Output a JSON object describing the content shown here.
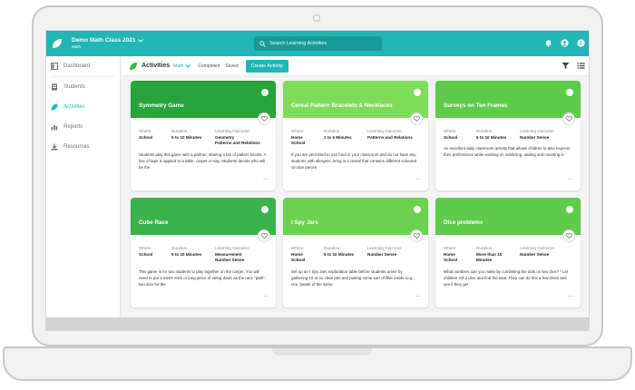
{
  "app": {
    "class_name": "Demo Math Class 2021",
    "subject": "Math",
    "search_placeholder": "Search Learning Activities"
  },
  "sidebar": {
    "items": [
      {
        "label": "Dashboard",
        "icon": "dashboard-icon",
        "active": false
      },
      {
        "label": "Students",
        "icon": "students-icon",
        "active": false
      },
      {
        "label": "Activities",
        "icon": "leaf-icon",
        "active": true
      },
      {
        "label": "Reports",
        "icon": "reports-icon",
        "active": false
      },
      {
        "label": "Resources",
        "icon": "resources-icon",
        "active": false
      }
    ]
  },
  "toolbar": {
    "title": "Activities",
    "filter": "Math",
    "completed": "Completed",
    "saved": "Saved",
    "create": "Create Activity"
  },
  "labels": {
    "where": "Where",
    "duration": "Duration",
    "outcome": "Learning Outcome"
  },
  "colors": {
    "teal": "#22b5b5",
    "green_dark": "#27a43a",
    "green_light": "#7ed957",
    "green_mid": "#5cc94a"
  },
  "cards": [
    {
      "title": "Symmetry Game",
      "color": "#27a43a",
      "where": [
        "School"
      ],
      "duration": [
        "5 to 10 Minutes"
      ],
      "outcome": [
        "Geometry",
        "Patterns and Relations"
      ],
      "description": "Students play this game with a partner, sharing a bin of pattern blocks. A line of tape is applied to a table, carpet or tray. Students decide who will be the"
    },
    {
      "title": "Cereal Pattern Bracelets & Necklaces",
      "color": "#7fdc5a",
      "where": [
        "Home",
        "School"
      ],
      "duration": [
        "2 to 5 Minutes"
      ],
      "outcome": [
        "Patterns and Relations"
      ],
      "description": "If you are permitted to use food in your classroom and do not have any students with allergies, bring in a cereal that contains different coloured circular pieces"
    },
    {
      "title": "Surveys on Ten Frames",
      "color": "#5ecb4a",
      "where": [
        "School"
      ],
      "duration": [
        "5 to 10 Minutes"
      ],
      "outcome": [
        "Number Sense"
      ],
      "description": "An excellent daily classroom activity that allows children to also express their preferences while working on subitizing, adding and counting is"
    },
    {
      "title": "Cube Race",
      "color": "#3cb34a",
      "where": [
        "School"
      ],
      "duration": [
        "5 to 10 Minutes"
      ],
      "outcome": [
        "Measurement",
        "Number Sense"
      ],
      "description": "This game is for two students to play together on the carpet. You will need to put a metre stick or long piece of string down as the race \"path\", two dice for the"
    },
    {
      "title": "I Spy Jars",
      "color": "#6ad24e",
      "where": [
        "Home",
        "School"
      ],
      "duration": [
        "5 to 10 Minutes"
      ],
      "outcome": [
        "Number Sense"
      ],
      "description": "Set up an I Spy Jars exploration table before students arrive by gathering 10 or so clear jars and putting some sort of filler inside (e.g., rice, beads of the same"
    },
    {
      "title": "Dice problems",
      "color": "#5ecb4a",
      "where": [
        "Home",
        "School"
      ],
      "duration": [
        "More than 10",
        "Minutes"
      ],
      "outcome": [
        "Number Sense"
      ],
      "description": "What numbers can you make by combining the dots on two dice? * Let children roll 2 dice and find the total. They can do this a few times and see if they get"
    }
  ]
}
